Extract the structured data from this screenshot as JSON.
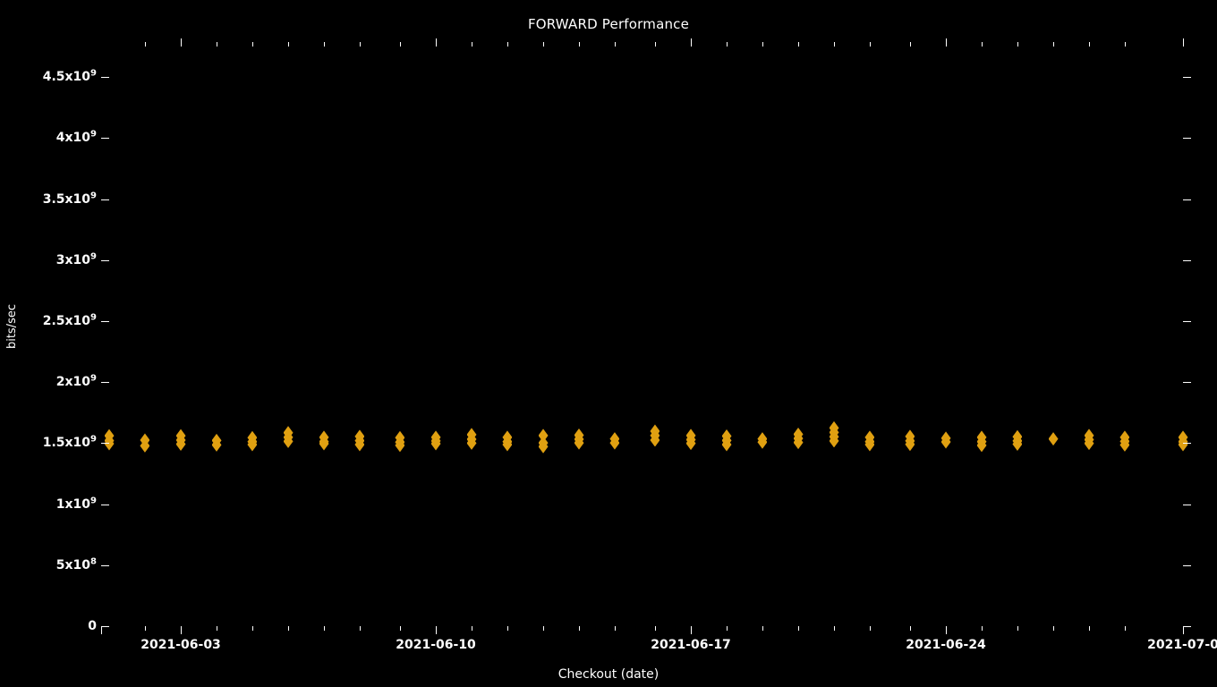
{
  "chart_data": {
    "type": "scatter",
    "title": "FORWARD Performance",
    "xlabel": "Checkout (date)",
    "ylabel": "bits/sec",
    "grid": false,
    "legend": null,
    "background_color": "#000000",
    "foreground_color": "#ffffff",
    "marker_color": "#e0a011",
    "marker_shape": "diamond",
    "ylim": [
      0,
      4750000000
    ],
    "y_ticks": [
      {
        "value": 4500000000,
        "label": "4.5x10",
        "exponent": "9"
      },
      {
        "value": 4000000000,
        "label": "4x10",
        "exponent": "9"
      },
      {
        "value": 3500000000,
        "label": "3.5x10",
        "exponent": "9"
      },
      {
        "value": 3000000000,
        "label": "3x10",
        "exponent": "9"
      },
      {
        "value": 2500000000,
        "label": "2.5x10",
        "exponent": "9"
      },
      {
        "value": 2000000000,
        "label": "2x10",
        "exponent": "9"
      },
      {
        "value": 1500000000,
        "label": "1.5x10",
        "exponent": "9"
      },
      {
        "value": 1000000000,
        "label": "1x10",
        "exponent": "9"
      },
      {
        "value": 500000000,
        "label": "5x10",
        "exponent": "8"
      },
      {
        "value": 0,
        "label": "0",
        "exponent": ""
      }
    ],
    "x_ticks": [
      {
        "position": 0.0667,
        "label": "2021-06-03"
      },
      {
        "position": 0.3042,
        "label": "2021-06-10"
      },
      {
        "position": 0.5417,
        "label": "2021-06-17"
      },
      {
        "position": 0.7792,
        "label": "2021-06-24"
      },
      {
        "position": 1.0,
        "label": "2021-07-0"
      }
    ],
    "x_minor_tick_positions": [
      0.0333,
      0.1,
      0.1333,
      0.1667,
      0.2,
      0.2333,
      0.2708,
      0.3375,
      0.3708,
      0.4042,
      0.4375,
      0.4708,
      0.5083,
      0.575,
      0.6083,
      0.6417,
      0.675,
      0.7083,
      0.7458,
      0.8125,
      0.8458,
      0.8792,
      0.9125,
      0.9458
    ],
    "series": [
      {
        "name": "FORWARD",
        "marker": "diamond",
        "color": "#e0a011",
        "points": [
          {
            "x": 0.0,
            "y": 1560000000
          },
          {
            "x": 0.0,
            "y": 1520000000
          },
          {
            "x": 0.0,
            "y": 1495000000
          },
          {
            "x": 0.0333,
            "y": 1525000000
          },
          {
            "x": 0.0333,
            "y": 1478000000
          },
          {
            "x": 0.0667,
            "y": 1560000000
          },
          {
            "x": 0.0667,
            "y": 1525000000
          },
          {
            "x": 0.0667,
            "y": 1492000000
          },
          {
            "x": 0.1,
            "y": 1522000000
          },
          {
            "x": 0.1,
            "y": 1485000000
          },
          {
            "x": 0.1333,
            "y": 1545000000
          },
          {
            "x": 0.1333,
            "y": 1512000000
          },
          {
            "x": 0.1333,
            "y": 1488000000
          },
          {
            "x": 0.1667,
            "y": 1585000000
          },
          {
            "x": 0.1667,
            "y": 1548000000
          },
          {
            "x": 0.1667,
            "y": 1515000000
          },
          {
            "x": 0.2,
            "y": 1548000000
          },
          {
            "x": 0.2,
            "y": 1512000000
          },
          {
            "x": 0.2,
            "y": 1495000000
          },
          {
            "x": 0.2333,
            "y": 1555000000
          },
          {
            "x": 0.2333,
            "y": 1520000000
          },
          {
            "x": 0.2333,
            "y": 1488000000
          },
          {
            "x": 0.2708,
            "y": 1545000000
          },
          {
            "x": 0.2708,
            "y": 1508000000
          },
          {
            "x": 0.2708,
            "y": 1482000000
          },
          {
            "x": 0.3042,
            "y": 1548000000
          },
          {
            "x": 0.3042,
            "y": 1518000000
          },
          {
            "x": 0.3042,
            "y": 1495000000
          },
          {
            "x": 0.3375,
            "y": 1570000000
          },
          {
            "x": 0.3375,
            "y": 1532000000
          },
          {
            "x": 0.3375,
            "y": 1500000000
          },
          {
            "x": 0.3708,
            "y": 1548000000
          },
          {
            "x": 0.3708,
            "y": 1512000000
          },
          {
            "x": 0.3708,
            "y": 1488000000
          },
          {
            "x": 0.4042,
            "y": 1562000000
          },
          {
            "x": 0.4042,
            "y": 1502000000
          },
          {
            "x": 0.4042,
            "y": 1472000000
          },
          {
            "x": 0.4375,
            "y": 1565000000
          },
          {
            "x": 0.4375,
            "y": 1532000000
          },
          {
            "x": 0.4375,
            "y": 1502000000
          },
          {
            "x": 0.4708,
            "y": 1535000000
          },
          {
            "x": 0.4708,
            "y": 1502000000
          },
          {
            "x": 0.5083,
            "y": 1598000000
          },
          {
            "x": 0.5083,
            "y": 1562000000
          },
          {
            "x": 0.5083,
            "y": 1525000000
          },
          {
            "x": 0.5417,
            "y": 1562000000
          },
          {
            "x": 0.5417,
            "y": 1528000000
          },
          {
            "x": 0.5417,
            "y": 1498000000
          },
          {
            "x": 0.575,
            "y": 1558000000
          },
          {
            "x": 0.575,
            "y": 1522000000
          },
          {
            "x": 0.575,
            "y": 1488000000
          },
          {
            "x": 0.6083,
            "y": 1535000000
          },
          {
            "x": 0.6083,
            "y": 1508000000
          },
          {
            "x": 0.6417,
            "y": 1572000000
          },
          {
            "x": 0.6417,
            "y": 1538000000
          },
          {
            "x": 0.6417,
            "y": 1505000000
          },
          {
            "x": 0.675,
            "y": 1625000000
          },
          {
            "x": 0.675,
            "y": 1588000000
          },
          {
            "x": 0.675,
            "y": 1552000000
          },
          {
            "x": 0.675,
            "y": 1518000000
          },
          {
            "x": 0.7083,
            "y": 1548000000
          },
          {
            "x": 0.7083,
            "y": 1512000000
          },
          {
            "x": 0.7083,
            "y": 1488000000
          },
          {
            "x": 0.7458,
            "y": 1555000000
          },
          {
            "x": 0.7458,
            "y": 1518000000
          },
          {
            "x": 0.7458,
            "y": 1490000000
          },
          {
            "x": 0.7792,
            "y": 1540000000
          },
          {
            "x": 0.7792,
            "y": 1510000000
          },
          {
            "x": 0.8125,
            "y": 1548000000
          },
          {
            "x": 0.8125,
            "y": 1512000000
          },
          {
            "x": 0.8125,
            "y": 1482000000
          },
          {
            "x": 0.8458,
            "y": 1552000000
          },
          {
            "x": 0.8458,
            "y": 1518000000
          },
          {
            "x": 0.8458,
            "y": 1492000000
          },
          {
            "x": 0.8792,
            "y": 1535000000
          },
          {
            "x": 0.9125,
            "y": 1562000000
          },
          {
            "x": 0.9125,
            "y": 1528000000
          },
          {
            "x": 0.9125,
            "y": 1498000000
          },
          {
            "x": 0.9458,
            "y": 1548000000
          },
          {
            "x": 0.9458,
            "y": 1515000000
          },
          {
            "x": 0.9458,
            "y": 1485000000
          },
          {
            "x": 1.0,
            "y": 1548000000
          },
          {
            "x": 1.0,
            "y": 1512000000
          },
          {
            "x": 1.0,
            "y": 1488000000
          }
        ]
      }
    ]
  }
}
